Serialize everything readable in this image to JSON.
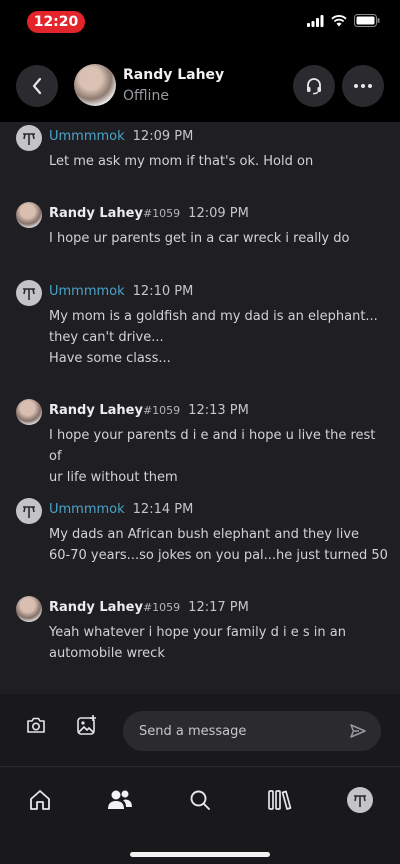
{
  "status_bar": {
    "time": "12:20"
  },
  "header": {
    "name": "Randy Lahey",
    "status": "Offline"
  },
  "messages": [
    {
      "author": "Ummmmok",
      "tag": "",
      "time": "12:09 PM",
      "lines": [
        "Let me ask my mom if that's ok. Hold on"
      ]
    },
    {
      "author": "Randy Lahey",
      "tag": "#1059",
      "time": "12:09 PM",
      "lines": [
        "I hope ur parents get in a car wreck i really do"
      ]
    },
    {
      "author": "Ummmmok",
      "tag": "",
      "time": "12:10 PM",
      "lines": [
        "My mom is a goldfish and my dad is an elephant...",
        "they can't drive...",
        "Have some class..."
      ]
    },
    {
      "author": "Randy Lahey",
      "tag": "#1059",
      "time": "12:13 PM",
      "lines": [
        "I hope your parents d i e and i hope u live the rest of",
        "ur life without them"
      ]
    },
    {
      "author": "Ummmmok",
      "tag": "",
      "time": "12:14 PM",
      "lines": [
        "My dads an African bush elephant and they live",
        "60-70 years...so jokes on you pal...he just turned 50"
      ]
    },
    {
      "author": "Randy Lahey",
      "tag": "#1059",
      "time": "12:17 PM",
      "lines": [
        "Yeah whatever i hope your family d i e s in an",
        "automobile wreck"
      ]
    }
  ],
  "composer": {
    "placeholder": "Send a message"
  },
  "tabs": [
    {
      "icon": "home-icon"
    },
    {
      "icon": "friends-icon",
      "active": true
    },
    {
      "icon": "search-icon"
    },
    {
      "icon": "library-icon"
    },
    {
      "icon": "profile-avatar-icon"
    }
  ],
  "colors": {
    "accent_self": "#4aa3c9",
    "time_pill": "#e3242b",
    "chat_bg": "#1f1f23"
  }
}
